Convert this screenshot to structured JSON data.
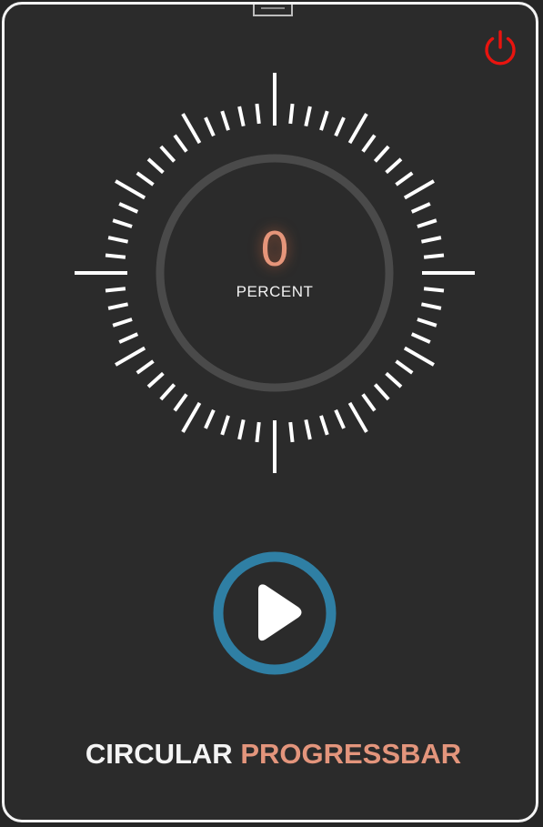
{
  "progress": {
    "value": "0",
    "label": "PERCENT",
    "fraction": 0
  },
  "title": {
    "part1": "CIRCULAR",
    "part2": "PROGRESSBAR"
  },
  "controls": {
    "power_icon": "power-icon",
    "play_icon": "play-icon"
  },
  "colors": {
    "background": "#2b2b2b",
    "frame": "#f3f3f3",
    "ticks": "#ffffff",
    "ring_track": "#4a4a4a",
    "value": "#e6957a",
    "accent_title": "#e3957c",
    "power": "#e8140f",
    "play_ring": "#2f7fa4"
  }
}
